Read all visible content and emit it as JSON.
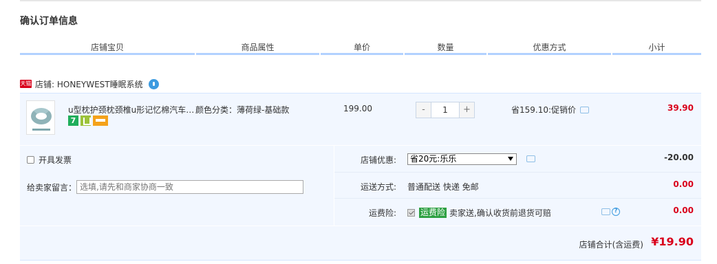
{
  "page": {
    "title": "确认订单信息"
  },
  "header": {
    "columns": [
      "店铺宝贝",
      "商品属性",
      "单价",
      "数量",
      "优惠方式",
      "小计"
    ]
  },
  "shop": {
    "badge": "天猫",
    "name": "店铺: HONEYWEST睡眠系统"
  },
  "item": {
    "title": "u型枕护颈枕颈椎u形记忆棉汽车…",
    "attributes": "颜色分类：薄荷绿-基础款",
    "unit_price": "199.00",
    "quantity": "1",
    "qty_minus": "-",
    "qty_plus": "+",
    "discount": "省159.10:促销价",
    "subtotal": "39.90",
    "badge_7": "7"
  },
  "options": {
    "invoice_label": "开具发票",
    "memo_label": "给卖家留言：",
    "memo_placeholder": "选填,请先和商家协商一致",
    "shop_discount_label": "店铺优惠:",
    "shop_discount_selected": "省20元:乐乐",
    "shop_discount_amount": "-20.00",
    "shipping_label": "运送方式:",
    "shipping_value": "普通配送 快递 免邮",
    "shipping_amount": "0.00",
    "insurance_label": "运费险:",
    "insurance_tag": "运费险",
    "insurance_text": "卖家送,确认收货前退货可赔",
    "insurance_amount": "0.00",
    "help_icon_text": "?"
  },
  "total": {
    "label": "店铺合计(含运费)",
    "amount": "¥19.90"
  },
  "colors": {
    "price_red": "#d9001b",
    "header_blue": "#b2d1ff",
    "row_bg": "#f2f7ff",
    "insurance_green": "#2da042"
  }
}
